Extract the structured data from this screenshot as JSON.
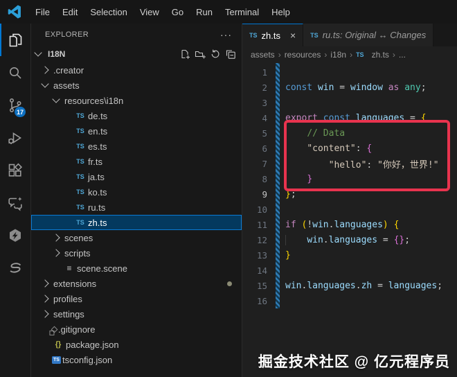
{
  "titlebar": {
    "menus": [
      "File",
      "Edit",
      "Selection",
      "View",
      "Go",
      "Run",
      "Terminal",
      "Help"
    ]
  },
  "activity_bar": {
    "items": [
      {
        "name": "explorer",
        "active": true
      },
      {
        "name": "search"
      },
      {
        "name": "source-control",
        "badge": "17"
      },
      {
        "name": "run-and-debug"
      },
      {
        "name": "extensions"
      },
      {
        "name": "chat"
      },
      {
        "name": "thunder-client"
      },
      {
        "name": "s-extension"
      }
    ]
  },
  "explorer": {
    "title": "EXPLORER",
    "more_glyph": "···",
    "section": "I18N",
    "actions": [
      "new-file",
      "new-folder",
      "refresh",
      "collapse-all"
    ],
    "icon_glyphs": {
      "ts": "TS",
      "tsconfig": "TS",
      "json": "{}",
      "scene": "≡"
    },
    "tree": [
      {
        "label": ".creator",
        "type": "folder",
        "state": "collapsed",
        "level": 0
      },
      {
        "label": "assets",
        "type": "folder",
        "state": "expanded",
        "level": 0
      },
      {
        "label": "resources\\i18n",
        "type": "folder",
        "state": "expanded",
        "level": 1
      },
      {
        "label": "de.ts",
        "type": "ts",
        "level": 2
      },
      {
        "label": "en.ts",
        "type": "ts",
        "level": 2
      },
      {
        "label": "es.ts",
        "type": "ts",
        "level": 2
      },
      {
        "label": "fr.ts",
        "type": "ts",
        "level": 2
      },
      {
        "label": "ja.ts",
        "type": "ts",
        "level": 2
      },
      {
        "label": "ko.ts",
        "type": "ts",
        "level": 2
      },
      {
        "label": "ru.ts",
        "type": "ts",
        "level": 2
      },
      {
        "label": "zh.ts",
        "type": "ts",
        "level": 2,
        "selected": true
      },
      {
        "label": "scenes",
        "type": "folder",
        "state": "collapsed",
        "level": 1
      },
      {
        "label": "scripts",
        "type": "folder",
        "state": "collapsed",
        "level": 1
      },
      {
        "label": "scene.scene",
        "type": "scene",
        "level": 1
      },
      {
        "label": "extensions",
        "type": "folder",
        "state": "collapsed",
        "level": 0,
        "dot": true
      },
      {
        "label": "profiles",
        "type": "folder",
        "state": "collapsed",
        "level": 0
      },
      {
        "label": "settings",
        "type": "folder",
        "state": "collapsed",
        "level": 0
      },
      {
        "label": ".gitignore",
        "type": "git",
        "level": 0
      },
      {
        "label": "package.json",
        "type": "json",
        "level": 0
      },
      {
        "label": "tsconfig.json",
        "type": "tsconfig",
        "level": 0
      }
    ]
  },
  "editor": {
    "tabs": [
      {
        "label": "zh.ts",
        "icon_text": "TS",
        "close_glyph": "×",
        "active": true
      },
      {
        "label": "ru.ts: Original ↔ Changes",
        "icon_text": "TS",
        "preview": true
      }
    ],
    "breadcrumb": [
      "assets",
      "resources",
      "i18n",
      "zh.ts",
      "..."
    ],
    "breadcrumb_sep": "›",
    "code": {
      "lines": [
        {
          "n": "1",
          "t": []
        },
        {
          "n": "2",
          "t": [
            [
              "kw",
              "const "
            ],
            [
              "var",
              "win"
            ],
            [
              "pun",
              " = "
            ],
            [
              "var",
              "window"
            ],
            [
              "ctl",
              " as "
            ],
            [
              "typ",
              "any"
            ],
            [
              "pun",
              ";"
            ]
          ]
        },
        {
          "n": "3",
          "t": []
        },
        {
          "n": "4",
          "t": [
            [
              "ctl",
              "export "
            ],
            [
              "kw",
              "const "
            ],
            [
              "var",
              "languages"
            ],
            [
              "pun",
              " = "
            ],
            [
              "b1",
              "{"
            ]
          ]
        },
        {
          "n": "5",
          "t": [
            [
              "ind",
              "    "
            ],
            [
              "cmt",
              "// Data"
            ]
          ]
        },
        {
          "n": "6",
          "t": [
            [
              "ind",
              "    "
            ],
            [
              "str",
              "\"content\""
            ],
            [
              "pun",
              ": "
            ],
            [
              "b2",
              "{"
            ]
          ]
        },
        {
          "n": "7",
          "t": [
            [
              "ind",
              "    "
            ],
            [
              "ind2",
              "    "
            ],
            [
              "str",
              "\"hello\""
            ],
            [
              "pun",
              ": "
            ],
            [
              "str",
              "\"你好，世界!\""
            ]
          ]
        },
        {
          "n": "8",
          "t": [
            [
              "ind",
              "    "
            ],
            [
              "b2",
              "}"
            ]
          ]
        },
        {
          "n": "9",
          "cur": true,
          "t": [
            [
              "b1",
              "}"
            ],
            [
              "pun",
              ";"
            ]
          ]
        },
        {
          "n": "10",
          "t": []
        },
        {
          "n": "11",
          "t": [
            [
              "ctl",
              "if "
            ],
            [
              "b1",
              "("
            ],
            [
              "pun",
              "!"
            ],
            [
              "var",
              "win"
            ],
            [
              "pun",
              "."
            ],
            [
              "var",
              "languages"
            ],
            [
              "b1",
              ")"
            ],
            [
              "pun",
              " "
            ],
            [
              "b1",
              "{"
            ]
          ]
        },
        {
          "n": "12",
          "t": [
            [
              "ind",
              "    "
            ],
            [
              "var",
              "win"
            ],
            [
              "pun",
              "."
            ],
            [
              "var",
              "languages"
            ],
            [
              "pun",
              " = "
            ],
            [
              "b2",
              "{}"
            ],
            [
              "pun",
              ";"
            ]
          ]
        },
        {
          "n": "13",
          "t": [
            [
              "b1",
              "}"
            ]
          ]
        },
        {
          "n": "14",
          "t": []
        },
        {
          "n": "15",
          "t": [
            [
              "var",
              "win"
            ],
            [
              "pun",
              "."
            ],
            [
              "var",
              "languages"
            ],
            [
              "pun",
              "."
            ],
            [
              "var",
              "zh"
            ],
            [
              "pun",
              " = "
            ],
            [
              "var",
              "languages"
            ],
            [
              "pun",
              ";"
            ]
          ]
        },
        {
          "n": "16",
          "t": []
        }
      ]
    },
    "watermark": "掘金技术社区 @ 亿元程序员"
  },
  "colors": {
    "accent": "#0078d4",
    "badge": "#0e70c0",
    "selection_bg": "#04395e",
    "selection_border": "#0b7bd4",
    "highlight_box": "#e8334e",
    "ts_icon": "#4fa8d8",
    "modified_gutter": "#2e7bb5"
  }
}
